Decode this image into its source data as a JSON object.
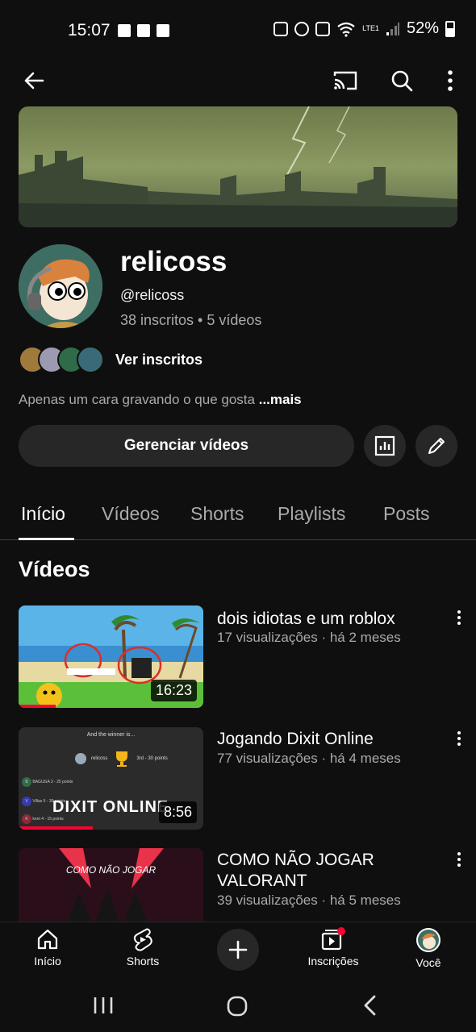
{
  "status_bar": {
    "time": "15:07",
    "battery": "52%",
    "network": "LTE1"
  },
  "top_bar": {
    "back_icon": "arrow-left-icon",
    "cast_icon": "cast-icon",
    "search_icon": "search-icon",
    "menu_icon": "more-vert-icon"
  },
  "channel": {
    "name": "relicoss",
    "handle": "@relicoss",
    "stats": "38 inscritos • 5 vídeos",
    "view_subscribers": "Ver inscritos",
    "description": "Apenas um cara gravando o que gosta",
    "more": "...mais",
    "manage_videos": "Gerenciar vídeos"
  },
  "tabs": [
    {
      "label": "Início"
    },
    {
      "label": "Vídeos"
    },
    {
      "label": "Shorts"
    },
    {
      "label": "Playlists"
    },
    {
      "label": "Posts"
    }
  ],
  "section": {
    "title": "Vídeos"
  },
  "videos": [
    {
      "title": "dois idiotas e um roblox",
      "meta": "17 visualizações · há 2 meses",
      "duration": "16:23",
      "progress": 0.2
    },
    {
      "title": "Jogando Dixit Online",
      "meta": "77 visualizações · há 4 meses",
      "duration": "8:56",
      "progress": 0.4,
      "thumb_text": "DIXIT ONLINE",
      "thumb_header": "And the winner is...",
      "thumb_winner": "relicoss",
      "thumb_winner_pts": "3rd - 30 points",
      "thumb_rows": [
        {
          "initial": "B",
          "name": "BAGUGA",
          "pts": "3 - 25 points"
        },
        {
          "initial": "V",
          "name": "Villas",
          "pts": "5 - 30 points"
        },
        {
          "initial": "K",
          "name": "kent",
          "pts": "4 - 15 points"
        }
      ]
    },
    {
      "title": "COMO NÃO JOGAR VALORANT",
      "meta": "39 visualizações · há 5 meses",
      "thumb_text": "COMO NÃO JOGAR"
    }
  ],
  "bottom_nav": [
    {
      "label": "Início",
      "icon": "home-icon"
    },
    {
      "label": "Shorts",
      "icon": "shorts-icon"
    },
    {
      "label": "",
      "icon": "plus-icon"
    },
    {
      "label": "Inscrições",
      "icon": "subscriptions-icon"
    },
    {
      "label": "Você",
      "icon": "avatar-icon"
    }
  ],
  "colors": {
    "background": "#0f0f0f",
    "surface": "#272727",
    "accent": "#ff0033",
    "secondary_text": "#aaaaaa"
  }
}
